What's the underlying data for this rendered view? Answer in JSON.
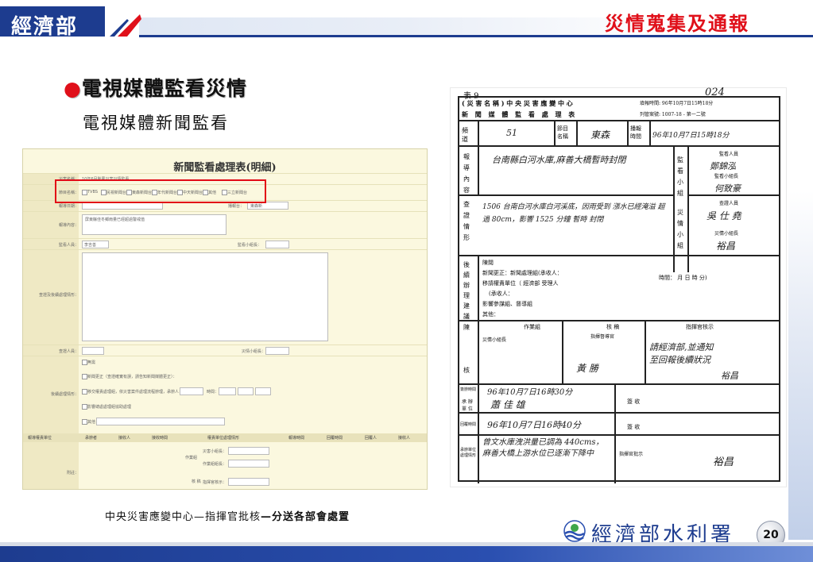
{
  "header": {
    "logo_text": "經濟部",
    "title": "災情蒐集及通報"
  },
  "left": {
    "bullet_heading": "電視媒體監看災情",
    "subheading": "電視媒體新聞監看"
  },
  "form": {
    "title": "新聞監看處理表(明細)",
    "labels": {
      "event_name": "災害名稱：",
      "program_name": "節目名稱：",
      "report_time": "報導日期：",
      "report_content": "報導內容：",
      "monitor": "監看人員：",
      "situation": "查證及後續處理情形：",
      "verifier": "查證人員：",
      "followup": "後續處理情形：",
      "remarks": "附註："
    },
    "right_labels": {
      "broadcast": "播報台：",
      "monitor_leader": "監看小組長：",
      "disaster_leader": "災情小組長："
    },
    "event_value": "10年6月颱風災害災情監看",
    "broadcast_value": "東森新",
    "monitor_value": "李吉善",
    "content_placeholder": "屏東縣佳冬鄉雨量已經超過警戒值",
    "channels": [
      "TVBS",
      "民視新聞台",
      "東森新聞台",
      "年代新聞台",
      "中天新聞台",
      "其他",
      "三立新聞台"
    ],
    "followup_options": [
      "無需",
      "新聞更正（查證確實有誤，請告知新聞媒體更正）：",
      "移交權責處理組，依災害案件處理流程辦理，承辦人：",
      "影響總處處理組協助處理",
      "其他"
    ],
    "followup_time_label": "時間：",
    "table_headers": [
      "報導權責單位",
      "承辦者",
      "接收人",
      "接收時間",
      "權責單位處理情形",
      "報導時間",
      "回覆時間",
      "回覆人",
      "接收人"
    ],
    "bottom_labels": {
      "action": "作業組",
      "verify": "核 稿",
      "r1": "災害小組長：",
      "r2": "作業組組長：",
      "r3": "指揮官核示："
    }
  },
  "document": {
    "doc_number": "表 9",
    "page_code": "024",
    "title_line1": "( 災 害 名 稱 ) 中 央 災 害 應 變 中 心",
    "title_line2": "新 聞 媒 體 監 看 處 理 表",
    "meta_right1": "填報時間: 96年10月7日15時18分",
    "meta_right2": "列管案號: 1007-18 - 第一二號",
    "row_channel_label": "頻 道",
    "row_channel_value": "51",
    "row_program_label": "節目名稱",
    "row_program_value": "東森",
    "row_time_label": "播報時間",
    "row_time_value": "96年10月7日15時18分",
    "content_label": "報 導 內 容",
    "content_value": "台南縣白河水庫,麻善大橋暫時封閉",
    "monitor_label": "監看小組",
    "monitor_person": "監看人員",
    "monitor_sign": "鄭錦泓",
    "leader_label": "監看小組長",
    "leader_sign": "何致豪",
    "verify_label": "查 證 情 形",
    "verify_text": "1506 台南白河水庫白河溪底，因雨受到 漲水已經淹溢 超過 80cm，影響 1525 分鐘 暫時 封閉",
    "disaster_label": "災 情 小 組",
    "disaster_person": "查證人員",
    "disaster_leader": "災情小組長",
    "disaster_sign": "吳 仕 堯",
    "followup_label": "後 續 辦 理 建 議",
    "followup_items": [
      "陳閱",
      "新聞更正：新聞處理組(承收人：",
      "移請權責單位（ 經濟部 受理人",
      "(承收人：",
      "影響參謀組、督導組",
      "其他："
    ],
    "followup_time": "時間：  月  日  時  分)",
    "chen_label": "陳",
    "chen_col1": "作業組",
    "chen_col2": "核 稿",
    "chen_col3": "指揮官核示",
    "chen_sub": "指揮督導官",
    "chen_hand1": "災情小組長",
    "chen_hand2": "請經濟部,並通知",
    "chen_hand3": "至回報後續狀況",
    "sign_label": "核",
    "sign_value": "黃 勝 ",
    "sign_time_label": "簽辦時間",
    "sign_time": "96年10月7日16時30分",
    "receive_label": "簽 收",
    "receiver_label": "承 辦 單 位",
    "receiver_value": "蕭 佳 雄",
    "reply_label": "回覆時間",
    "reply_time": "96年10月7日16時40分",
    "reply_receive": "簽 收",
    "result_label": "承辦單位處理情形",
    "result_text": "曾文水庫洩洪量已調為 440cms，麻善大橋上游水位已逐漸下降中",
    "commander_label": "指揮官批示",
    "commander_sign": "裕昌"
  },
  "caption": {
    "normal": "中央災害應變中心—指揮官批核",
    "bold": "—分送各部會處置"
  },
  "footer": {
    "org_logo_text": "經濟部水利署",
    "page_number": "20"
  },
  "colors": {
    "brand_blue": "#1d3c8f",
    "title_red": "#e0101a",
    "form_bg": "#fbf8df"
  }
}
